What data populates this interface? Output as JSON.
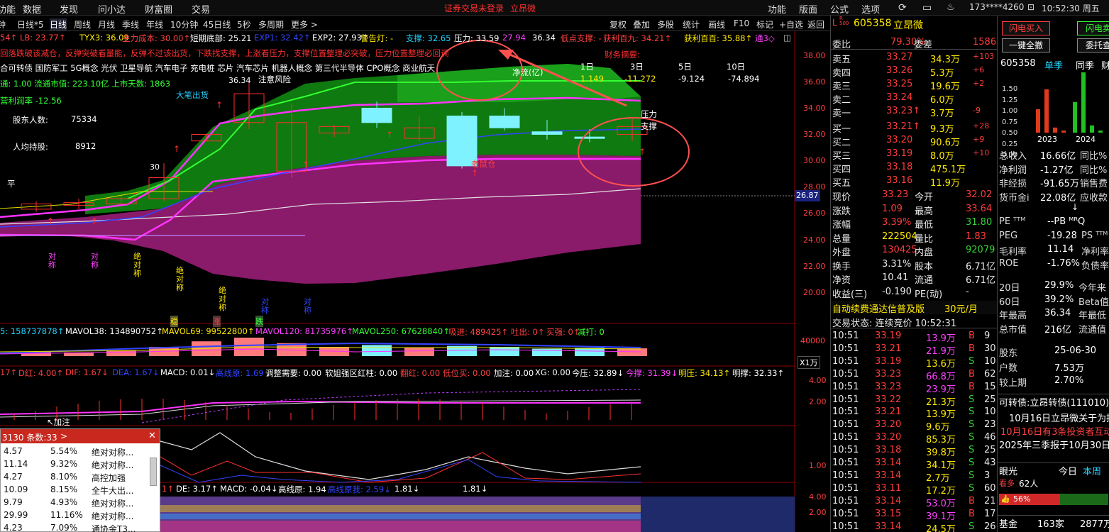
{
  "menu": {
    "items": [
      "功能",
      "数据",
      "发现",
      "问小达",
      "财富圈",
      "交易"
    ],
    "status": "证券交易未登录",
    "stock_link": "立昂微",
    "right_items": [
      "功能",
      "版面",
      "公式",
      "选项"
    ],
    "user": "173****4260",
    "time": "10:52:30 周五"
  },
  "period_bar": {
    "items": [
      "钟",
      "日线*5",
      "日线",
      "周线",
      "月线",
      "季线",
      "年线",
      "10分钟",
      "45日线",
      "5秒",
      "多周期",
      "更多 >"
    ],
    "tools": [
      "复权",
      "叠加",
      "多股",
      "统计",
      "画线",
      "F10",
      "标记",
      "+自选",
      "返回"
    ]
  },
  "overlays": {
    "ind_row1": [
      "54↑",
      "LB: 23.77↑",
      "TYX3: 36.09",
      "主力成本: 30.00↑",
      "短期底部: 25.21",
      "EXP1: 32.42↑",
      "EXP2: 27.93↑",
      "警告灯: -",
      "支撑: 32.65",
      "压力: 33.59",
      "27.94",
      "36.34",
      "低点支撑: -",
      "获利百九: 34.21↑",
      "获利百百: 35.88↑",
      "通3◇"
    ],
    "warning": "回落跌破该减仓，反弹突破看量能，反弹不过该出货，下跌找支撑，上涨看压力，支撑位置整理必突破，压力位置整理必回调",
    "concepts": "合可转债 国防军工 5G概念 光伏 卫星导航 汽车电子 充电桩 芯片 汽车芯片 机器人概念 第三代半导体 CPO概念 商业航天",
    "fund_label": "财务摘要:",
    "flow_label": "净流(亿)",
    "flow_cols": [
      "1日",
      "3日",
      "5日",
      "10日"
    ],
    "flow_vals": [
      "1.149",
      "-11.272",
      "-9.124",
      "-74.894"
    ],
    "cap_info": "通: 1.00 流通市值: 223.10亿 上市天数: 1863",
    "profit": "营利润率 -12.56",
    "holders_label": "股东人数:",
    "holders_value": "75334",
    "per_label": "人均持股:",
    "per_value": "8912",
    "price_tags": [
      "大笔出货",
      "注意风险",
      "老鼠仓",
      "压力",
      "支撑",
      "平",
      "36.34",
      "30"
    ],
    "marks": [
      "对称",
      "对称",
      "绝对称",
      "绝对称",
      "绝对称",
      "对称",
      "对称"
    ],
    "mini_marks": [
      "稳",
      "涨",
      "跌"
    ]
  },
  "chart_data": {
    "type": "candlestick",
    "y_axis": [
      "38.00",
      "36.00",
      "34.00",
      "32.00",
      "30.00",
      "28.00",
      "26.00",
      "24.00",
      "22.00",
      "20.00"
    ],
    "current_tag": "26.87",
    "candles": [
      {
        "o": 26.6,
        "c": 27.0,
        "h": 27.2,
        "l": 26.4
      },
      {
        "o": 26.9,
        "c": 27.1,
        "h": 27.4,
        "l": 26.6
      },
      {
        "o": 27.0,
        "c": 27.4,
        "h": 27.6,
        "l": 26.8
      },
      {
        "o": 27.4,
        "c": 29.0,
        "h": 30.1,
        "l": 27.2
      },
      {
        "o": 31.8,
        "c": 32.3,
        "h": 32.3,
        "l": 31.8
      },
      {
        "o": 33.2,
        "c": 35.4,
        "h": 36.3,
        "l": 32.7
      },
      {
        "o": 29.5,
        "c": 33.2,
        "h": 34.6,
        "l": 29.0
      },
      {
        "o": 32.4,
        "c": 32.9,
        "h": 33.0,
        "l": 32.1
      },
      {
        "o": 34.3,
        "c": 33.2,
        "h": 34.8,
        "l": 32.8
      },
      {
        "o": 32.0,
        "c": 32.8,
        "h": 33.7,
        "l": 31.8
      },
      {
        "o": 33.7,
        "c": 29.9,
        "h": 34.0,
        "l": 29.7
      },
      {
        "o": 33.7,
        "c": 32.8,
        "h": 34.3,
        "l": 32.6
      },
      {
        "o": 32.5,
        "c": 32.3,
        "h": 33.4,
        "l": 31.9
      },
      {
        "o": 32.1,
        "c": 32.0,
        "h": 32.7,
        "l": 31.7
      },
      {
        "o": 32.3,
        "c": 32.9,
        "h": 33.5,
        "l": 31.8
      }
    ]
  },
  "vol_row": [
    "5: 158737878↑",
    "MAVOL38: 134890752↑",
    "MAVOL69: 99522800↑",
    "MAVOL120: 81735976↑",
    "MAVOL250: 67628840↑",
    "吸进: 489425↑",
    "吐出: 0↑",
    "买强: 0↑",
    "减打: 0"
  ],
  "vol_axis": [
    "40000",
    "X1万"
  ],
  "macd_row": [
    "17↑",
    "D红: 4.00↑",
    "DIF: 1.67↓",
    "DEA: 1.67↓",
    "MACD: 0.01↓",
    "高线原: 1.69",
    "调整需要: 0.00",
    "软姐强区红柱: 0.00",
    "翻红: 0.00",
    "低位买: 0.00",
    "加注: 0.00",
    "XG: 0.00",
    "今压: 32.89↓",
    "今撑: 31.39↓",
    "明压: 34.13↑",
    "明撑: 32.33↑"
  ],
  "macd_axis": [
    "4.00",
    "2.00"
  ],
  "add_mark": "↖加注",
  "mid_axis": [
    "1.00"
  ],
  "bot_row": [
    "1↑",
    "DE: 3.17↑",
    "MACD: -0.04↓",
    "高线原: 1.94",
    "高线原我: 2.59↓",
    "1.81↓",
    "1.81↓"
  ],
  "bot_axis": [
    "4.00",
    "2.00"
  ],
  "popup": {
    "title": "3130 条数:33",
    "arrow": ">",
    "rows": [
      [
        "4.57",
        "5.54%",
        "绝对对称..."
      ],
      [
        "11.14",
        "9.32%",
        "绝对对称..."
      ],
      [
        "4.27",
        "8.10%",
        "高控加强"
      ],
      [
        "10.09",
        "8.15%",
        "全牛大出..."
      ],
      [
        "9.79",
        "4.93%",
        "绝对对称..."
      ],
      [
        "29.99",
        "11.16%",
        "绝对对称..."
      ],
      [
        "4.23",
        "7.09%",
        "通协金T3..."
      ]
    ]
  },
  "quote": {
    "prefix": "L",
    "code_sup": "R 500",
    "code": "605358",
    "name": "立昂微",
    "weibi_label": "委比",
    "weibi": "79.30%",
    "weicha_label": "委差",
    "weicha": "1586",
    "sells": [
      [
        "卖五",
        "33.27",
        "34.3万",
        "+103"
      ],
      [
        "卖四",
        "33.26",
        "5.3万",
        "+6"
      ],
      [
        "卖三",
        "33.25",
        "19.6万",
        "+2"
      ],
      [
        "卖二",
        "33.24",
        "6.0万",
        ""
      ],
      [
        "卖一",
        "33.23↑",
        "3.7万",
        "-9"
      ]
    ],
    "buys": [
      [
        "买一",
        "33.21↑",
        "9.3万",
        "+28"
      ],
      [
        "买二",
        "33.20",
        "90.6万",
        "+9"
      ],
      [
        "买三",
        "33.19",
        "8.0万",
        "+10"
      ],
      [
        "买四",
        "33.18",
        "475.1万",
        ""
      ],
      [
        "买五",
        "33.16",
        "11.9万",
        ""
      ]
    ],
    "stats": [
      [
        "现价",
        "33.23",
        "今开",
        "32.02"
      ],
      [
        "涨跌",
        "1.09",
        "最高",
        "33.64"
      ],
      [
        "涨幅",
        "3.39%",
        "最低",
        "31.80"
      ],
      [
        "总量",
        "222504",
        "量比",
        "1.83"
      ],
      [
        "外盘",
        "130425",
        "内盘",
        "92079"
      ],
      [
        "换手",
        "3.31%",
        "股本",
        "6.71亿"
      ],
      [
        "净资",
        "10.41",
        "流通",
        "6.71亿"
      ],
      [
        "收益(三)",
        "-0.190",
        "PE(动)",
        "-"
      ]
    ],
    "promo": "自动续费通达信普及版",
    "promo_price": "30元/月",
    "trade_state": "交易状态: 连续竞价 10:52:31",
    "ticks": [
      [
        "10:51",
        "33.19",
        "13.9万",
        "B",
        "9"
      ],
      [
        "10:51",
        "33.21",
        "21.9万",
        "B",
        "30"
      ],
      [
        "10:51",
        "33.19",
        "13.6万",
        "S",
        "10"
      ],
      [
        "10:51",
        "33.23",
        "66.8万",
        "B",
        "62"
      ],
      [
        "10:51",
        "33.23",
        "23.9万",
        "B",
        "15"
      ],
      [
        "10:51",
        "33.22",
        "21.3万",
        "S",
        "25"
      ],
      [
        "10:51",
        "33.21",
        "13.9万",
        "S",
        "10"
      ],
      [
        "10:51",
        "33.20",
        "9.6万",
        "S",
        "23"
      ],
      [
        "10:51",
        "33.20",
        "85.3万",
        "S",
        "46"
      ],
      [
        "10:51",
        "33.18",
        "39.8万",
        "S",
        "25"
      ],
      [
        "10:51",
        "33.14",
        "34.1万",
        "S",
        "43"
      ],
      [
        "10:51",
        "33.14",
        "2.7万",
        "S",
        "3"
      ],
      [
        "10:51",
        "33.11",
        "17.2万",
        "S",
        "60"
      ],
      [
        "10:51",
        "33.14",
        "53.0万",
        "B",
        "21"
      ],
      [
        "10:51",
        "33.15",
        "39.1万",
        "B",
        "17"
      ],
      [
        "10:51",
        "33.14",
        "24.5万",
        "S",
        "26"
      ]
    ]
  },
  "far": {
    "btn_buy": "闪电买入",
    "btn_sell": "闪电卖",
    "btn_cancel": "一键全撤",
    "btn_entrust": "委托查",
    "code": "605358",
    "tabs": [
      "单季",
      "同季",
      "财"
    ],
    "bar_years": [
      "2023",
      "2024"
    ],
    "bar_axis": [
      "1.50",
      "1.25",
      "1.00",
      "0.75",
      "0.50",
      "0.25",
      "0.00"
    ],
    "bar_values": [
      0.55,
      1.02,
      0.12,
      0.05,
      0.72,
      1.52,
      0.17,
      0.05
    ],
    "fin": [
      [
        "总收入",
        "16.66亿",
        "同比%"
      ],
      [
        "净利润",
        "-1.27亿",
        "同比%"
      ],
      [
        "非经损",
        "-91.65万",
        "销售费"
      ],
      [
        "货币金i",
        "22.08亿",
        "应收款"
      ]
    ],
    "fin_down": "↓",
    "val": [
      [
        "PE ᵀᵀᴹ",
        "--PB ᴹᴿQ",
        ""
      ],
      [
        "PEG",
        "-19.28",
        "PS ᵀᵀᴹ"
      ],
      [
        "毛利率",
        "11.14",
        "净利率"
      ],
      [
        "ROE",
        "-1.76%",
        "负债率"
      ]
    ],
    "perf": [
      [
        "20日",
        "29.9%",
        "今年来"
      ],
      [
        "60日",
        "39.2%",
        "Beta值"
      ],
      [
        "年最高",
        "36.34",
        "年最低"
      ],
      [
        "总市值",
        "216亿",
        "流通值"
      ]
    ],
    "holder": [
      [
        "股东",
        "25-06-30"
      ],
      [
        "户数",
        "7.53万"
      ],
      [
        "较上期",
        "2.70%"
      ]
    ],
    "bond": "可转债:立昂转债(111010)",
    "news": [
      "10月16日立昂微关于为控",
      "10月16日有3条投资者互动",
      "2025年三季报于10月30日"
    ],
    "eye_label": "眼光",
    "eye_tabs": [
      "今日",
      "本周"
    ],
    "bull_label": "看多",
    "bull_count": "62人",
    "bull_pct": "56%",
    "fund_label": "基金",
    "fund_count": "163家",
    "fund_amt": "2877万"
  }
}
